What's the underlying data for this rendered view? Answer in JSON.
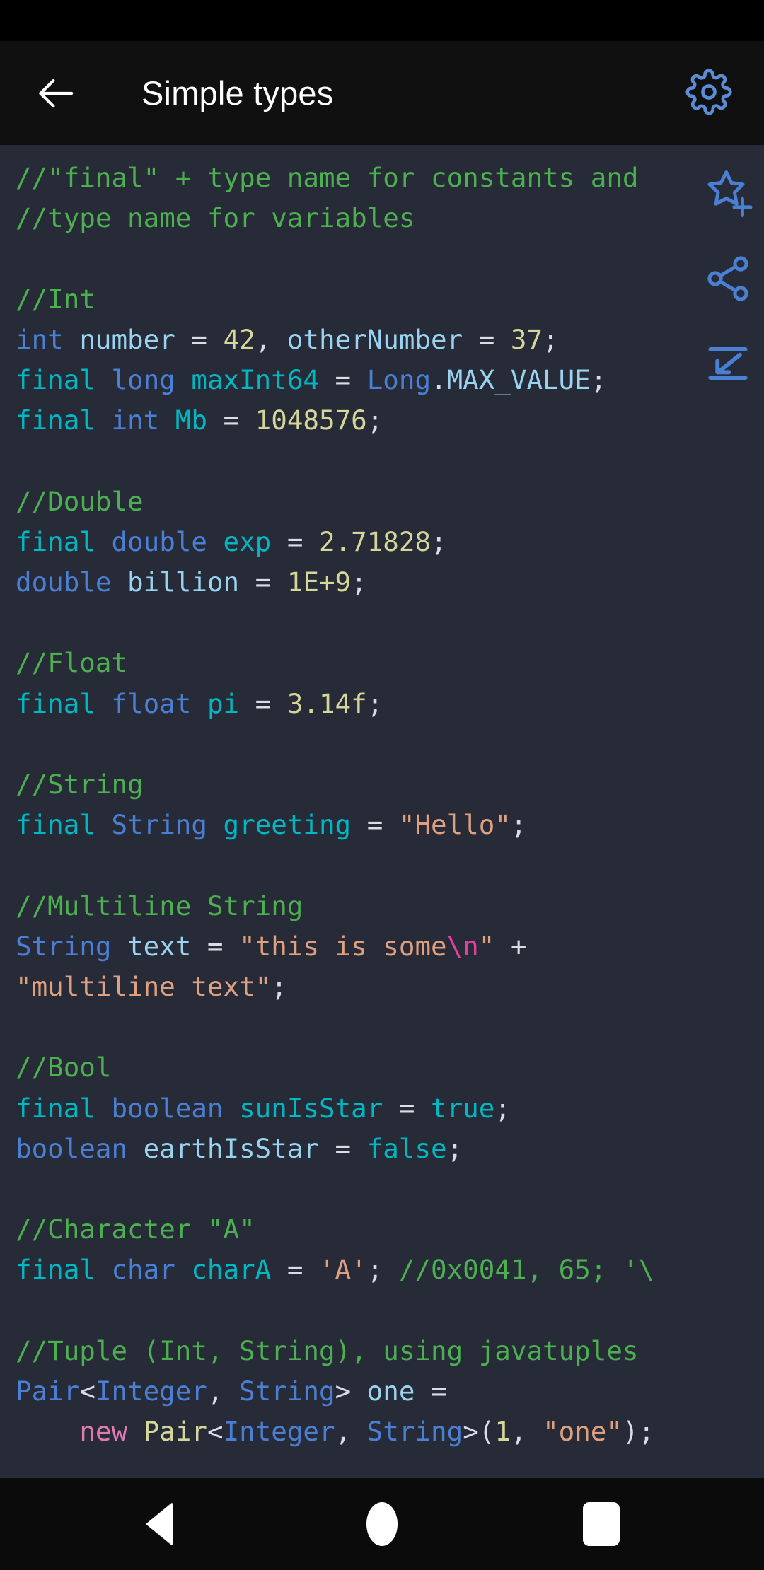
{
  "app": {
    "title": "Simple types"
  },
  "toolbar": {
    "back_icon": "arrow-left-icon",
    "title": "Simple types",
    "settings_icon": "gear-icon",
    "settings_color": "#5b8dd6"
  },
  "floating_actions": [
    {
      "name": "add-to-favorites",
      "icon": "star-plus-icon",
      "color": "#4a7fd4"
    },
    {
      "name": "share",
      "icon": "share-icon",
      "color": "#4a7fd4"
    },
    {
      "name": "word-wrap-toggle",
      "icon": "word-wrap-icon",
      "color": "#4a7fd4"
    }
  ],
  "navbar": {
    "back": "back-triangle-icon",
    "home": "home-circle-icon",
    "recents": "recents-square-icon"
  },
  "editor": {
    "background": "#272b38",
    "language": "java",
    "lines": [
      [
        {
          "t": "cmt",
          "v": "//\"final\" + type name for constants and"
        }
      ],
      [
        {
          "t": "cmt",
          "v": "//type name for variables"
        }
      ],
      [
        {
          "t": "pun",
          "v": ""
        }
      ],
      [
        {
          "t": "cmt",
          "v": "//Int"
        }
      ],
      [
        {
          "t": "kw",
          "v": "int"
        },
        {
          "t": "pun",
          "v": " "
        },
        {
          "t": "var",
          "v": "number"
        },
        {
          "t": "pun",
          "v": " = "
        },
        {
          "t": "num",
          "v": "42"
        },
        {
          "t": "pun",
          "v": ", "
        },
        {
          "t": "var",
          "v": "otherNumber"
        },
        {
          "t": "pun",
          "v": " = "
        },
        {
          "t": "num",
          "v": "37"
        },
        {
          "t": "pun",
          "v": ";"
        }
      ],
      [
        {
          "t": "fin",
          "v": "final"
        },
        {
          "t": "pun",
          "v": " "
        },
        {
          "t": "kw",
          "v": "long"
        },
        {
          "t": "pun",
          "v": " "
        },
        {
          "t": "fin",
          "v": "maxInt64"
        },
        {
          "t": "pun",
          "v": " = "
        },
        {
          "t": "cls",
          "v": "Long"
        },
        {
          "t": "pun",
          "v": "."
        },
        {
          "t": "mem",
          "v": "MAX_VALUE"
        },
        {
          "t": "pun",
          "v": ";"
        }
      ],
      [
        {
          "t": "fin",
          "v": "final"
        },
        {
          "t": "pun",
          "v": " "
        },
        {
          "t": "kw",
          "v": "int"
        },
        {
          "t": "pun",
          "v": " "
        },
        {
          "t": "fin",
          "v": "Mb"
        },
        {
          "t": "pun",
          "v": " = "
        },
        {
          "t": "num",
          "v": "1048576"
        },
        {
          "t": "pun",
          "v": ";"
        }
      ],
      [
        {
          "t": "pun",
          "v": ""
        }
      ],
      [
        {
          "t": "cmt",
          "v": "//Double"
        }
      ],
      [
        {
          "t": "fin",
          "v": "final"
        },
        {
          "t": "pun",
          "v": " "
        },
        {
          "t": "kw",
          "v": "double"
        },
        {
          "t": "pun",
          "v": " "
        },
        {
          "t": "fin",
          "v": "exp"
        },
        {
          "t": "pun",
          "v": " = "
        },
        {
          "t": "num",
          "v": "2.71828"
        },
        {
          "t": "pun",
          "v": ";"
        }
      ],
      [
        {
          "t": "kw",
          "v": "double"
        },
        {
          "t": "pun",
          "v": " "
        },
        {
          "t": "var",
          "v": "billion"
        },
        {
          "t": "pun",
          "v": " = "
        },
        {
          "t": "num",
          "v": "1E+9"
        },
        {
          "t": "pun",
          "v": ";"
        }
      ],
      [
        {
          "t": "pun",
          "v": ""
        }
      ],
      [
        {
          "t": "cmt",
          "v": "//Float"
        }
      ],
      [
        {
          "t": "fin",
          "v": "final"
        },
        {
          "t": "pun",
          "v": " "
        },
        {
          "t": "kw",
          "v": "float"
        },
        {
          "t": "pun",
          "v": " "
        },
        {
          "t": "fin",
          "v": "pi"
        },
        {
          "t": "pun",
          "v": " = "
        },
        {
          "t": "num",
          "v": "3.14f"
        },
        {
          "t": "pun",
          "v": ";"
        }
      ],
      [
        {
          "t": "pun",
          "v": ""
        }
      ],
      [
        {
          "t": "cmt",
          "v": "//String"
        }
      ],
      [
        {
          "t": "fin",
          "v": "final"
        },
        {
          "t": "pun",
          "v": " "
        },
        {
          "t": "cls",
          "v": "String"
        },
        {
          "t": "pun",
          "v": " "
        },
        {
          "t": "fin",
          "v": "greeting"
        },
        {
          "t": "pun",
          "v": " = "
        },
        {
          "t": "str",
          "v": "\"Hello\""
        },
        {
          "t": "pun",
          "v": ";"
        }
      ],
      [
        {
          "t": "pun",
          "v": ""
        }
      ],
      [
        {
          "t": "cmt",
          "v": "//Multiline String"
        }
      ],
      [
        {
          "t": "cls",
          "v": "String"
        },
        {
          "t": "pun",
          "v": " "
        },
        {
          "t": "var",
          "v": "text"
        },
        {
          "t": "pun",
          "v": " = "
        },
        {
          "t": "str",
          "v": "\"this is some"
        },
        {
          "t": "esc",
          "v": "\\n"
        },
        {
          "t": "str",
          "v": "\""
        },
        {
          "t": "pun",
          "v": " +"
        }
      ],
      [
        {
          "t": "str",
          "v": "\"multiline text\""
        },
        {
          "t": "pun",
          "v": ";"
        }
      ],
      [
        {
          "t": "pun",
          "v": ""
        }
      ],
      [
        {
          "t": "cmt",
          "v": "//Bool"
        }
      ],
      [
        {
          "t": "fin",
          "v": "final"
        },
        {
          "t": "pun",
          "v": " "
        },
        {
          "t": "kw",
          "v": "boolean"
        },
        {
          "t": "pun",
          "v": " "
        },
        {
          "t": "fin",
          "v": "sunIsStar"
        },
        {
          "t": "pun",
          "v": " = "
        },
        {
          "t": "fin",
          "v": "true"
        },
        {
          "t": "pun",
          "v": ";"
        }
      ],
      [
        {
          "t": "kw",
          "v": "boolean"
        },
        {
          "t": "pun",
          "v": " "
        },
        {
          "t": "var",
          "v": "earthIsStar"
        },
        {
          "t": "pun",
          "v": " = "
        },
        {
          "t": "fin",
          "v": "false"
        },
        {
          "t": "pun",
          "v": ";"
        }
      ],
      [
        {
          "t": "pun",
          "v": ""
        }
      ],
      [
        {
          "t": "cmt",
          "v": "//Character \"A\""
        }
      ],
      [
        {
          "t": "fin",
          "v": "final"
        },
        {
          "t": "pun",
          "v": " "
        },
        {
          "t": "kw",
          "v": "char"
        },
        {
          "t": "pun",
          "v": " "
        },
        {
          "t": "fin",
          "v": "charA"
        },
        {
          "t": "pun",
          "v": " = "
        },
        {
          "t": "str",
          "v": "'A'"
        },
        {
          "t": "pun",
          "v": "; "
        },
        {
          "t": "cmt",
          "v": "//0x0041, 65; '\\"
        }
      ],
      [
        {
          "t": "pun",
          "v": ""
        }
      ],
      [
        {
          "t": "cmt",
          "v": "//Tuple (Int, String), using javatuples"
        }
      ],
      [
        {
          "t": "cls",
          "v": "Pair"
        },
        {
          "t": "pun",
          "v": "<"
        },
        {
          "t": "cls",
          "v": "Integer"
        },
        {
          "t": "pun",
          "v": ", "
        },
        {
          "t": "cls",
          "v": "String"
        },
        {
          "t": "pun",
          "v": "> "
        },
        {
          "t": "var",
          "v": "one"
        },
        {
          "t": "pun",
          "v": " ="
        }
      ],
      [
        {
          "t": "pun",
          "v": "    "
        },
        {
          "t": "new",
          "v": "new"
        },
        {
          "t": "pun",
          "v": " "
        },
        {
          "t": "ctor",
          "v": "Pair"
        },
        {
          "t": "pun",
          "v": "<"
        },
        {
          "t": "cls",
          "v": "Integer"
        },
        {
          "t": "pun",
          "v": ", "
        },
        {
          "t": "cls",
          "v": "String"
        },
        {
          "t": "pun",
          "v": ">("
        },
        {
          "t": "num",
          "v": "1"
        },
        {
          "t": "pun",
          "v": ", "
        },
        {
          "t": "str",
          "v": "\"one\""
        },
        {
          "t": "pun",
          "v": ");"
        }
      ]
    ]
  }
}
